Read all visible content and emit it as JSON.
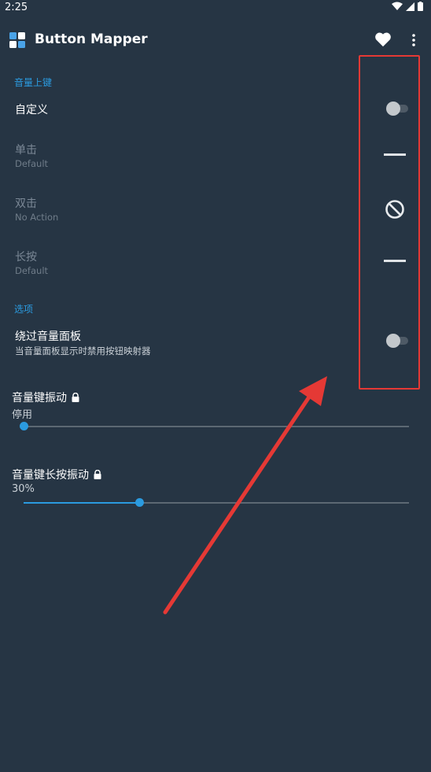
{
  "status_bar": {
    "time": "2:25"
  },
  "app_bar": {
    "title": "Button Mapper"
  },
  "volume_up_section": {
    "header": "音量上键",
    "custom": {
      "title": "自定义",
      "enabled": false
    },
    "single_press": {
      "title": "单击",
      "value": "Default"
    },
    "double_press": {
      "title": "双击",
      "value": "No Action"
    },
    "long_press": {
      "title": "长按",
      "value": "Default"
    }
  },
  "options_section": {
    "header": "选项",
    "bypass_panel": {
      "title": "绕过音量面板",
      "description": "当音量面板显示时禁用按钮映射器",
      "enabled": false
    }
  },
  "vibration": {
    "press": {
      "title": "音量键振动",
      "value": "停用",
      "level": 0
    },
    "long_press": {
      "title": "音量键长按振动",
      "value": "30%",
      "level": 0.3
    }
  },
  "colors": {
    "background": "#263544",
    "accent": "#2b9be0",
    "highlight_box": "#e53935"
  }
}
